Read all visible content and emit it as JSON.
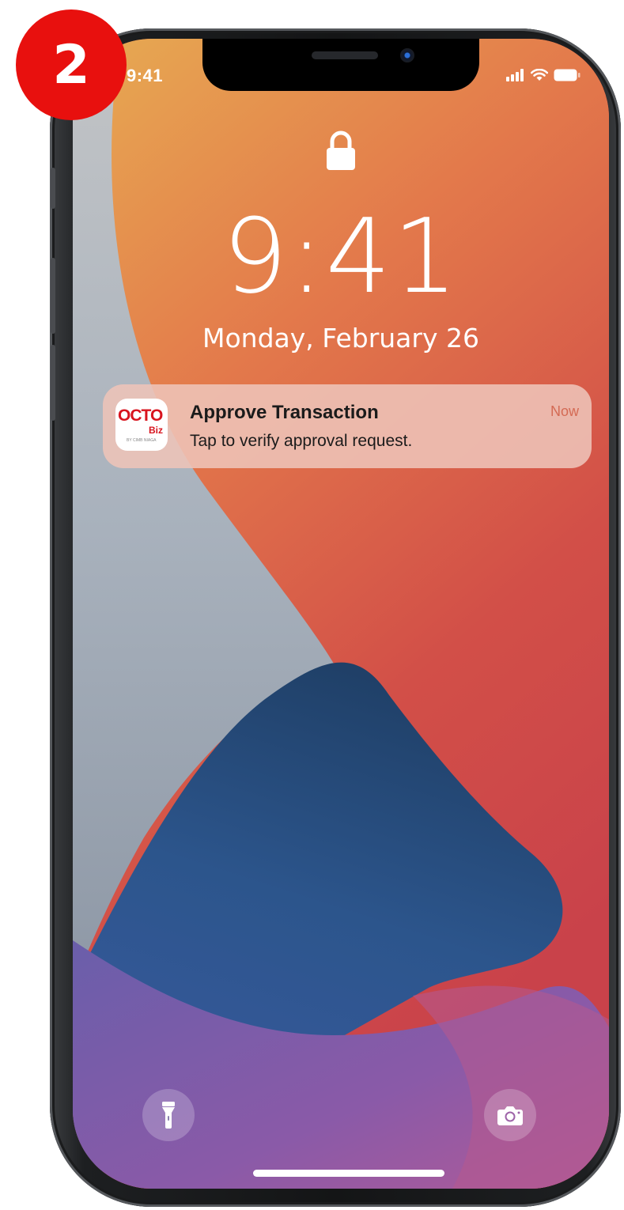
{
  "step_badge": "2",
  "status_bar": {
    "time": "9:41"
  },
  "lock_screen": {
    "clock": "9:41",
    "date": "Monday, February 26"
  },
  "notification": {
    "app_name": "OCTO",
    "app_sub": "Biz",
    "app_tiny": "BY CIMB NIAGA",
    "title": "Approve Transaction",
    "body": "Tap to verify approval request.",
    "time": "Now"
  },
  "quick_actions": {
    "left_icon": "flashlight-icon",
    "right_icon": "camera-icon"
  },
  "colors": {
    "badge": "#e8100e",
    "brand_red": "#d8141e",
    "notification_time": "#d46a54"
  }
}
